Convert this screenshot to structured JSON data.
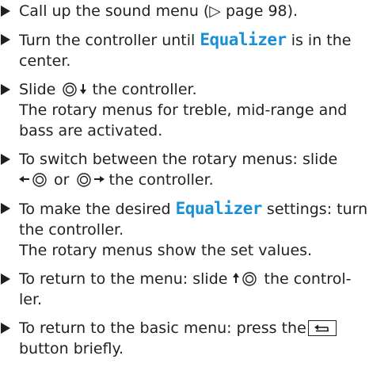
{
  "steps": [
    {
      "lines": [
        "Call up the sound menu (▷ page 98)."
      ]
    },
    {
      "line1_pre": "Turn the controller until ",
      "line1_hl": "Equalizer",
      "line1_post": " is in the",
      "line2": "center."
    },
    {
      "line1_pre": "Slide ",
      "line1_post": " the controller.",
      "line2": "The rotary menus for treble, mid-range and",
      "line3": "bass are activated."
    },
    {
      "line1": "To switch between the rotary menus: slide",
      "line2_mid": " or ",
      "line2_post": " the controller."
    },
    {
      "line1_pre": "To make the desired ",
      "line1_hl": "Equalizer",
      "line1_post": " settings: turn",
      "line2": "the controller.",
      "line3": "The rotary menus show the set values."
    },
    {
      "line1_pre": "To return to the menu: slide ",
      "line1_post": " the control-",
      "line2": "ler."
    },
    {
      "line1": "To return to the basic menu: press the",
      "line2": "button briefly."
    }
  ],
  "icons": {
    "bullet": "triangle-right-bullet",
    "controller": "controller-icon",
    "slide_down": "arrow-down-icon",
    "slide_up": "arrow-up-icon",
    "slide_left": "arrow-left-icon",
    "slide_right": "arrow-right-icon",
    "back_button": "back-button-icon"
  },
  "colors": {
    "text": "#231f20",
    "highlight": "#1a8fd6"
  }
}
